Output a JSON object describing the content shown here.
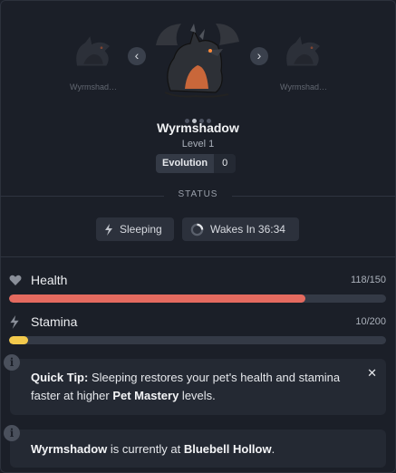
{
  "carousel": {
    "prev_pet_name": "Wyrmshad…",
    "next_pet_name": "Wyrmshad…",
    "prev_arrow": "‹",
    "next_arrow": "›",
    "active_index": 1,
    "dot_count": 4
  },
  "pet": {
    "name": "Wyrmshadow",
    "level": "Level 1",
    "evolution_label": "Evolution",
    "evolution_value": "0"
  },
  "status": {
    "title": "STATUS",
    "state": "Sleeping",
    "wake": "Wakes In 36:34"
  },
  "stats": {
    "health": {
      "label": "Health",
      "value": "118/150",
      "fraction": 0.787,
      "color": "#e46a5f"
    },
    "stamina": {
      "label": "Stamina",
      "value": "10/200",
      "fraction": 0.05,
      "color": "#f2c94c"
    }
  },
  "tip": {
    "prefix": "Quick Tip:",
    "text1": " Sleeping restores your pet's health and stamina faster at higher ",
    "bold2": "Pet Mastery",
    "text2": " levels.",
    "close": "✕"
  },
  "location": {
    "pet": "Wyrmshadow",
    "text": " is currently at ",
    "place": "Bluebell Hollow",
    "end": "."
  },
  "icons": {
    "info": "i",
    "health": "heart-icon",
    "stamina": "lightning-icon",
    "sleep": "lightning-icon",
    "wake": "spinner-icon"
  }
}
